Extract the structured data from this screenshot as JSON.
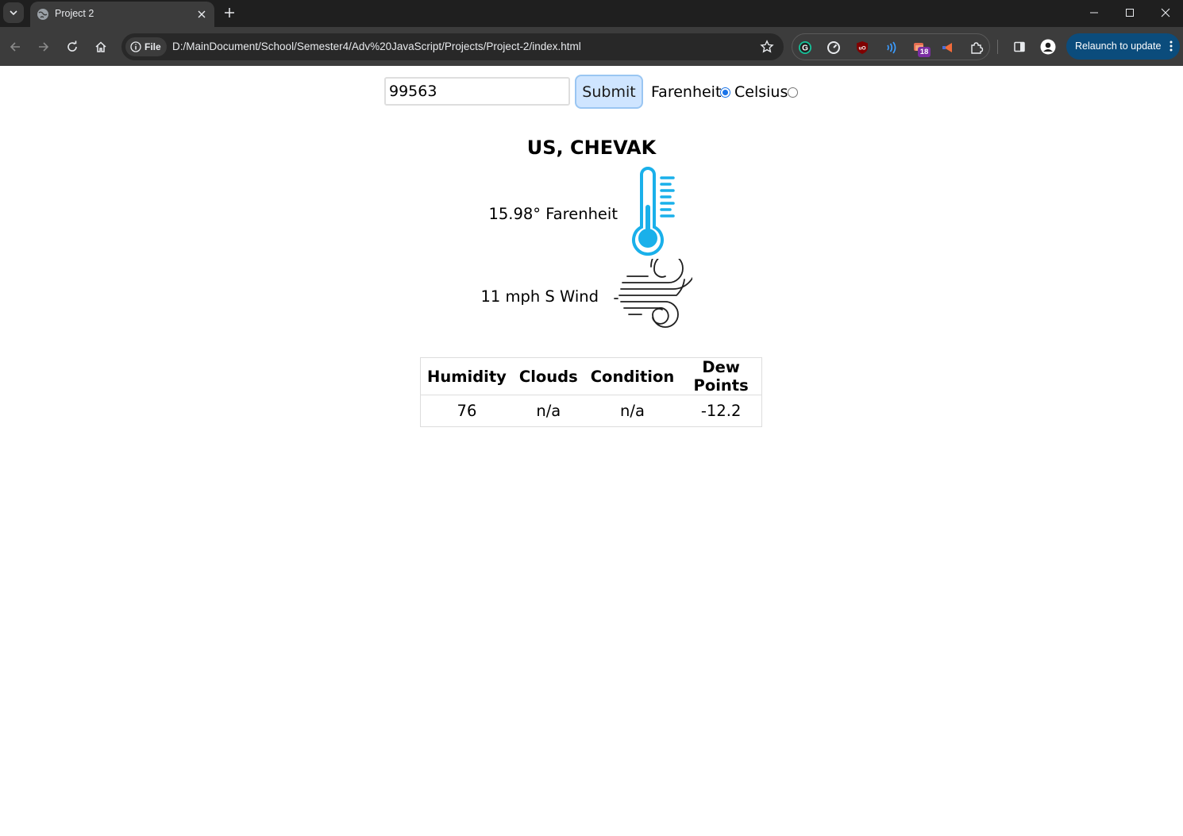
{
  "browser": {
    "tab_title": "Project 2",
    "site_chip": "File",
    "url": "D:/MainDocument/School/Semester4/Adv%20JavaScript/Projects/Project-2/index.html",
    "extension_badge": "18",
    "relaunch_label": "Relaunch to update",
    "accent_color": "#0b4c7c"
  },
  "form": {
    "zip_value": "99563",
    "submit_label": "Submit",
    "units": [
      {
        "label": "Farenheit",
        "checked": true
      },
      {
        "label": "Celsius",
        "checked": false
      }
    ]
  },
  "weather": {
    "location": "US, CHEVAK",
    "temperature": "15.98° Farenheit",
    "wind": "11 mph S Wind",
    "temperature_icon": "thermometer-icon",
    "wind_icon": "wind-icon",
    "icon_color": "#1ab0ea"
  },
  "table": {
    "headers": [
      "Humidity",
      "Clouds",
      "Condition",
      "Dew Points"
    ],
    "rows": [
      [
        "76",
        "n/a",
        "n/a",
        "-12.2"
      ]
    ]
  }
}
